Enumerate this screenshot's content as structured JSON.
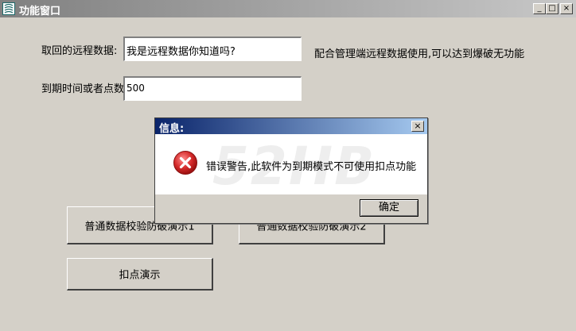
{
  "window": {
    "title": "功能窗口",
    "minimize_glyph": "_",
    "maximize_glyph": "□",
    "close_glyph": "×"
  },
  "form": {
    "remote_label": "取回的远程数据:",
    "remote_value": "我是远程数据你知道吗?",
    "remote_hint": "配合管理端远程数据使用,可以达到爆破无功能",
    "expiry_label": "到期时间或者点数:",
    "expiry_value": "500"
  },
  "buttons": {
    "verify1": "普通数据校验防破演示1",
    "verify2": "普通数据校验防破演示2",
    "deduct": "扣点演示"
  },
  "dialog": {
    "title": "信息:",
    "close_glyph": "×",
    "watermark": "52HB",
    "message": "错误警告,此软件为到期模式不可使用扣点功能",
    "ok_label": "确定",
    "icon": "error-icon",
    "error_color": "#cc2222"
  }
}
